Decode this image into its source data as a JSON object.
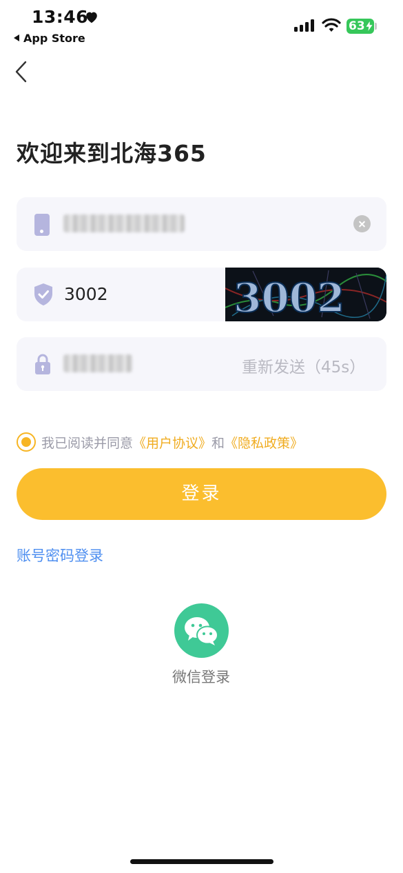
{
  "status_bar": {
    "time": "13:46",
    "back_app": "App Store",
    "battery": "63",
    "battery_color": "#36c75a"
  },
  "nav": {
    "back_icon": "chevron-left-icon"
  },
  "page_title": "欢迎来到北海365",
  "phone_field": {
    "icon": "phone-icon",
    "value_blurred": true,
    "clear_icon": "clear-icon"
  },
  "captcha_field": {
    "icon": "shield-check-icon",
    "value": "3002",
    "captcha_image_text": "3002"
  },
  "sms_field": {
    "icon": "lock-icon",
    "value_blurred": true,
    "resend_label": "重新发送（45s）"
  },
  "agreement": {
    "prefix": "我已阅读并同意",
    "user_agreement": "《用户协议》",
    "and": "和",
    "privacy_policy": "《隐私政策》",
    "checked": true
  },
  "login_button": {
    "label": "登录",
    "color": "#fbbe2e"
  },
  "password_login_link": "账号密码登录",
  "wechat_login": {
    "icon": "wechat-icon",
    "label": "微信登录",
    "color": "#3fc996"
  }
}
